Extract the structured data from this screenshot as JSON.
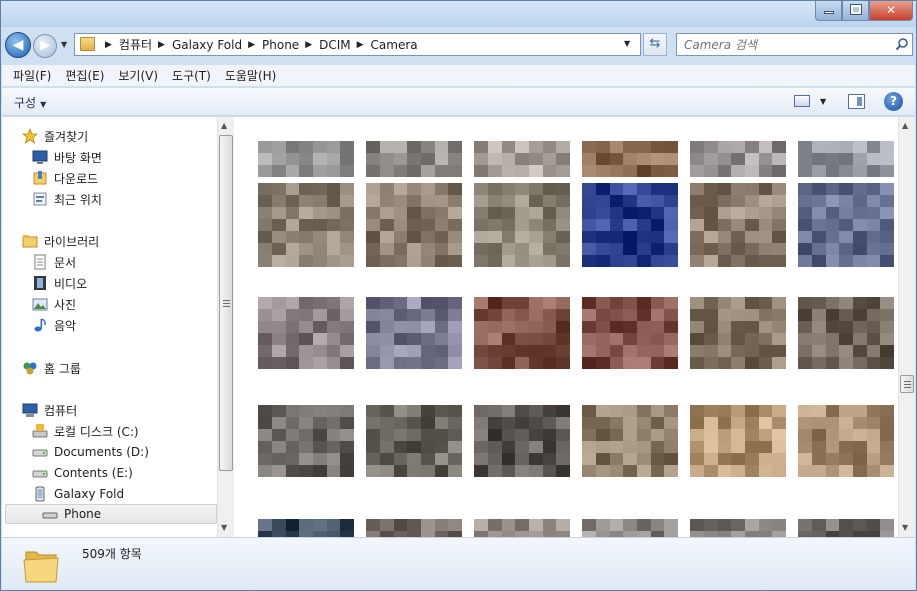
{
  "window": {
    "controls": {
      "minimize": "",
      "maximize": "",
      "close": "✕"
    }
  },
  "address_bar": {
    "crumbs": [
      "컴퓨터",
      "Galaxy Fold",
      "Phone",
      "DCIM",
      "Camera"
    ]
  },
  "search": {
    "placeholder": "Camera 검색"
  },
  "menu": [
    "파일(F)",
    "편집(E)",
    "보기(V)",
    "도구(T)",
    "도움말(H)"
  ],
  "toolbar": {
    "organize_label": "구성",
    "help_label": "?"
  },
  "nav": {
    "favorites": {
      "label": "즐겨찾기",
      "items": [
        "바탕 화면",
        "다운로드",
        "최근 위치"
      ]
    },
    "libraries": {
      "label": "라이브러리",
      "items": [
        "문서",
        "비디오",
        "사진",
        "음악"
      ]
    },
    "homegroup": {
      "label": "홈 그룹"
    },
    "computer": {
      "label": "컴퓨터",
      "items": [
        "로컬 디스크 (C:)",
        "Documents (D:)",
        "Contents (E:)",
        "Galaxy Fold",
        "Phone"
      ]
    }
  },
  "status": {
    "item_count": "509개 항목"
  },
  "thumbnail_colors": [
    [
      "#9a9a9a",
      "#8d8a86",
      "#a8a29a",
      "#8b6a52",
      "#9a9494",
      "#9aa0a6"
    ],
    [
      "#8f8478",
      "#8a7d70",
      "#8e8779",
      "#2b3f8c",
      "#8f7f70",
      "#6b7494"
    ],
    [
      "#8a7f82",
      "#7d7e95",
      "#7f5348",
      "#7f5148",
      "#847766",
      "#6e645a"
    ],
    [
      "#6d6a66",
      "#6a6660",
      "#5e5955",
      "#8f7e6a",
      "#b69a78",
      "#a88f72"
    ],
    [
      "#3e4a5e",
      "#7d7570",
      "#8d8680",
      "#8b8886",
      "#7e7a76",
      "#6f6c6a"
    ]
  ]
}
